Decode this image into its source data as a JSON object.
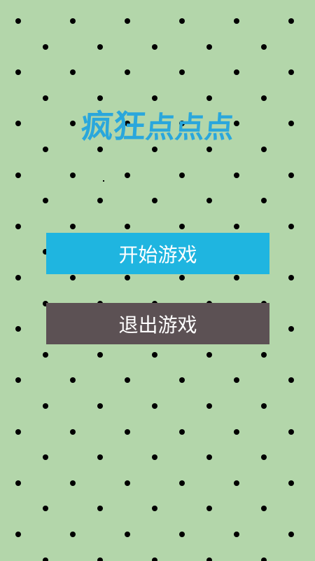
{
  "title": {
    "part1": "疯狂",
    "part2": "点点点",
    "color": "#2aa7dc"
  },
  "buttons": {
    "start": {
      "label": "开始游戏",
      "color": "#1fb5e0"
    },
    "exit": {
      "label": "退出游戏",
      "color": "#5c5154"
    }
  },
  "background": {
    "color": "#b3d6aa",
    "dot_color": "#000000"
  }
}
